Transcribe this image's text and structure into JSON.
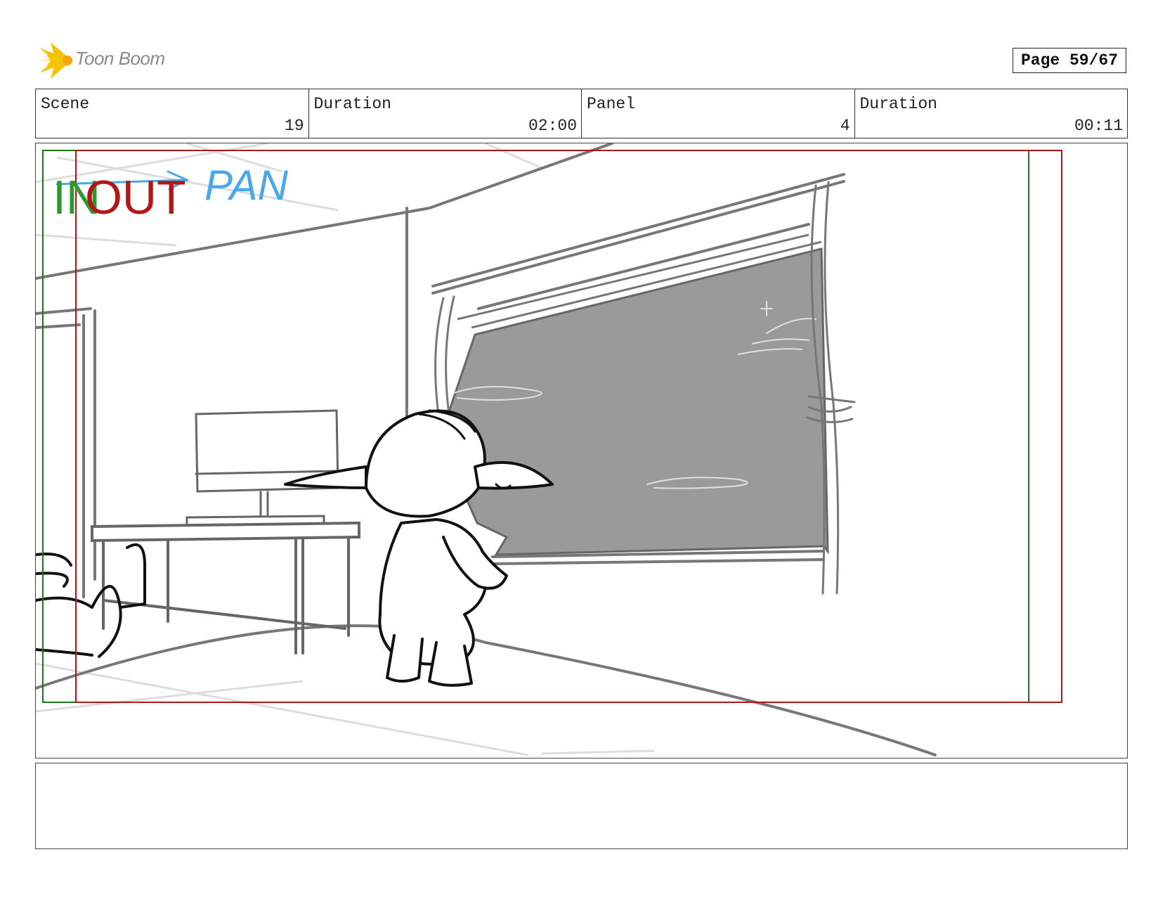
{
  "logo": {
    "text": "Toon Boom",
    "icon": "starburst-logo-icon"
  },
  "page_indicator": "Page 59/67",
  "header": {
    "scene_label": "Scene",
    "scene_value": "19",
    "scene_duration_label": "Duration",
    "scene_duration_value": "02:00",
    "panel_label": "Panel",
    "panel_value": "4",
    "panel_duration_label": "Duration",
    "panel_duration_value": "00:11"
  },
  "panel_art": {
    "in_label": "IN",
    "out_label": "OUT",
    "camera_note": "PAN",
    "colors": {
      "in_frame": "#1a7a1a",
      "out_frame": "#b01818",
      "pan_note": "#4aa8e8",
      "sky": "#9a9a9a"
    }
  },
  "notes": {
    "text": ""
  }
}
